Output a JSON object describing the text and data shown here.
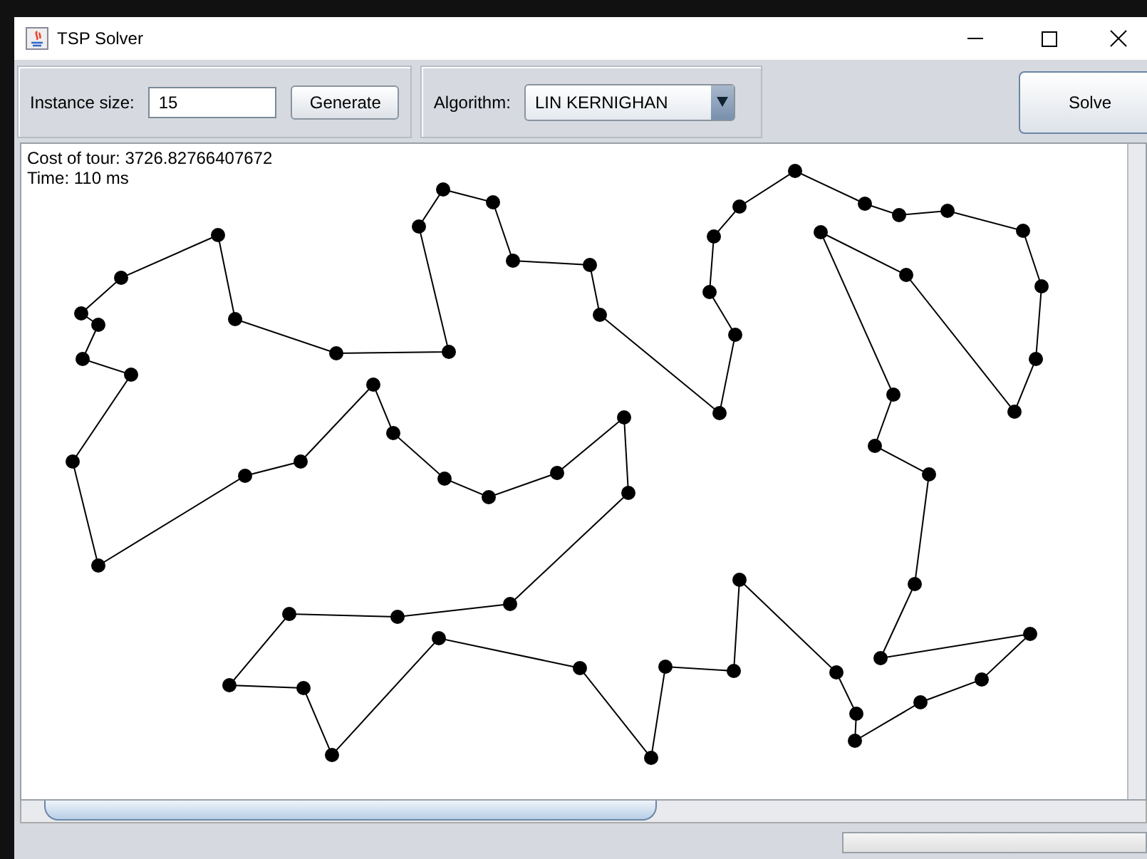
{
  "window": {
    "title": "TSP Solver"
  },
  "toolbar": {
    "instance_size": {
      "label": "Instance size:",
      "value": "15"
    },
    "generate_button": "Generate",
    "algorithm": {
      "label": "Algorithm:",
      "value": "LIN KERNIGHAN"
    },
    "solve_button": "Solve"
  },
  "canvas": {
    "cost": "Cost of tour: 3726.82766407672",
    "time": "Time: 110 ms"
  },
  "progress": {
    "level": 0
  }
}
